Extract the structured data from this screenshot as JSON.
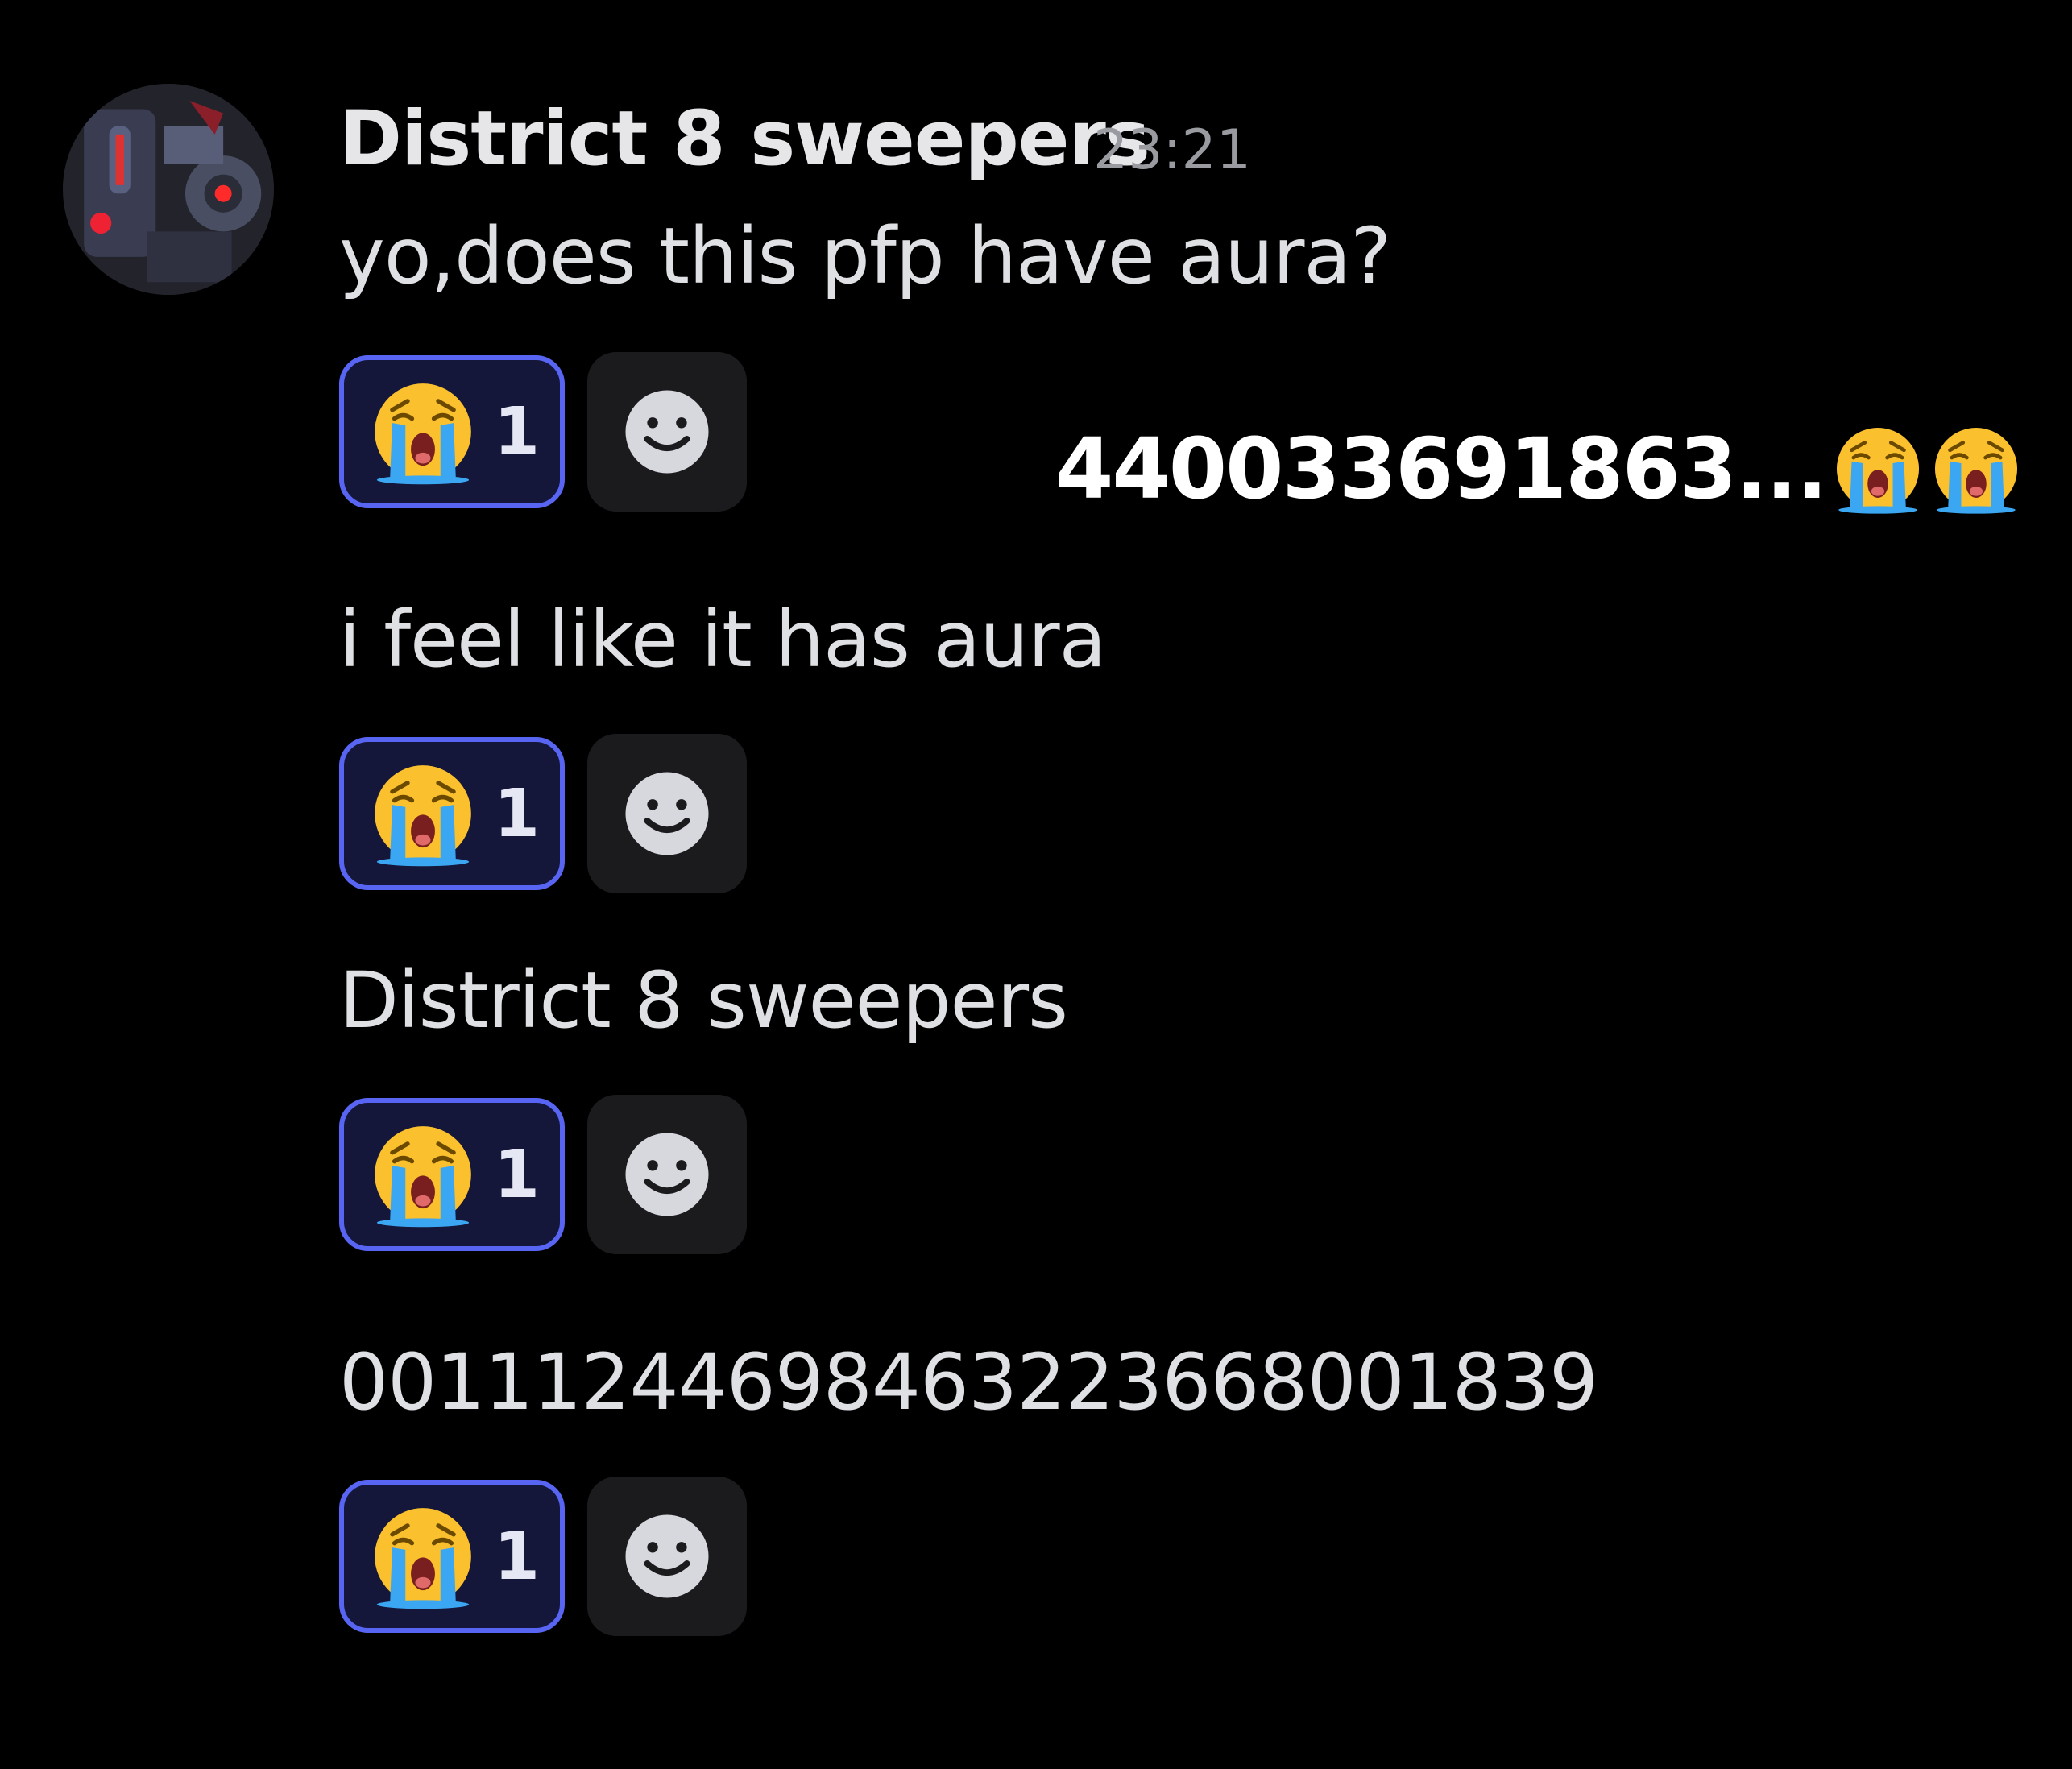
{
  "message": {
    "username": "District 8 sweepers",
    "timestamp": "23:21",
    "avatar_icon": "robot-avatar"
  },
  "messages": [
    {
      "text": "yo,does this pfp have aura?",
      "reaction": {
        "emoji": "loudly-crying-face",
        "count": "1"
      }
    },
    {
      "text": "i feel like it has aura",
      "reaction": {
        "emoji": "loudly-crying-face",
        "count": "1"
      }
    },
    {
      "text": "District 8 sweepers",
      "reaction": {
        "emoji": "loudly-crying-face",
        "count": "1"
      }
    },
    {
      "text": "0011124469846322366800183‌9",
      "reaction": {
        "emoji": "loudly-crying-face",
        "count": "1"
      }
    }
  ],
  "add_reaction_icon": "smiley-face-icon",
  "overlay": {
    "text": "440033691863...",
    "emojis": [
      "loudly-crying-face",
      "loudly-crying-face"
    ]
  },
  "colors": {
    "background": "#000000",
    "reaction_border": "#5865f2",
    "reaction_bg": "#14163a",
    "add_reaction_bg": "#1b1b1e"
  }
}
